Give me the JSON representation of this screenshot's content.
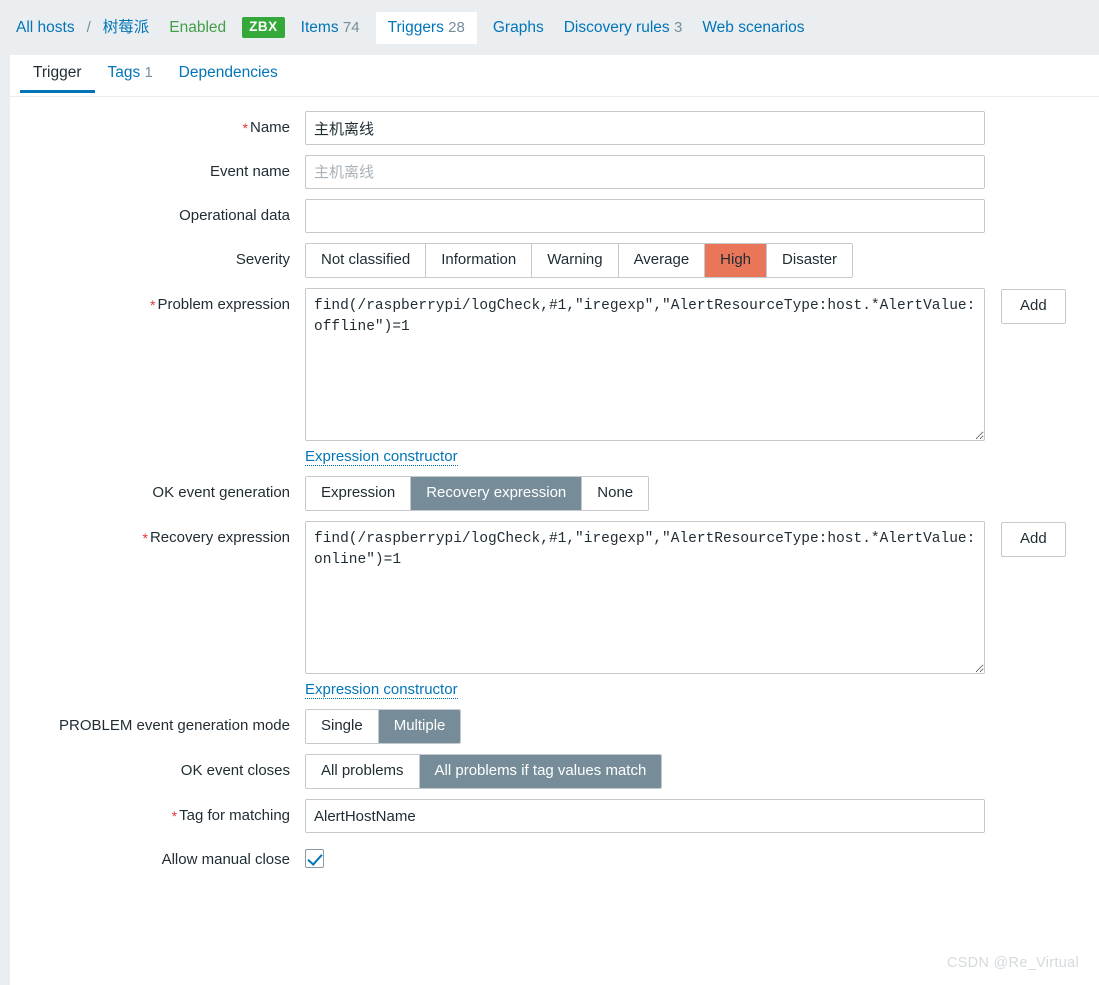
{
  "hostnav": {
    "all_hosts": "All hosts",
    "separator": "/",
    "host_name": "树莓派",
    "status": "Enabled",
    "agent_badge": "ZBX",
    "items_label": "Items",
    "items_count": "74",
    "triggers_label": "Triggers",
    "triggers_count": "28",
    "graphs_label": "Graphs",
    "discovery_label": "Discovery rules",
    "discovery_count": "3",
    "web_label": "Web scenarios"
  },
  "tabs": {
    "trigger": "Trigger",
    "tags": "Tags",
    "tags_count": "1",
    "dependencies": "Dependencies"
  },
  "form": {
    "name": {
      "label": "Name",
      "value": "主机离线",
      "placeholder": ""
    },
    "event_name": {
      "label": "Event name",
      "value": "",
      "placeholder": "主机离线"
    },
    "operational_data": {
      "label": "Operational data",
      "value": "",
      "placeholder": ""
    },
    "severity": {
      "label": "Severity",
      "options": [
        "Not classified",
        "Information",
        "Warning",
        "Average",
        "High",
        "Disaster"
      ],
      "selected": "High",
      "selected_color": "#e97659"
    },
    "problem_expression": {
      "label": "Problem expression",
      "value": "find(/raspberrypi/logCheck,#1,\"iregexp\",\"AlertResourceType:host.*AlertValue:offline\")=1",
      "add_label": "Add",
      "constructor_label": "Expression constructor"
    },
    "ok_event_generation": {
      "label": "OK event generation",
      "options": [
        "Expression",
        "Recovery expression",
        "None"
      ],
      "selected": "Recovery expression"
    },
    "recovery_expression": {
      "label": "Recovery expression",
      "value": "find(/raspberrypi/logCheck,#1,\"iregexp\",\"AlertResourceType:host.*AlertValue:online\")=1",
      "add_label": "Add",
      "constructor_label": "Expression constructor"
    },
    "problem_event_generation_mode": {
      "label": "PROBLEM event generation mode",
      "options": [
        "Single",
        "Multiple"
      ],
      "selected": "Multiple"
    },
    "ok_event_closes": {
      "label": "OK event closes",
      "options": [
        "All problems",
        "All problems if tag values match"
      ],
      "selected": "All problems if tag values match"
    },
    "tag_for_matching": {
      "label": "Tag for matching",
      "value": "AlertHostName",
      "placeholder": ""
    },
    "allow_manual_close": {
      "label": "Allow manual close",
      "checked": true
    }
  },
  "watermark": "CSDN @Re_Virtual",
  "colors": {
    "link": "#0275b8",
    "enabled": "#429e47",
    "badge": "#34a93a",
    "selected": "#768d99",
    "required": "#e33734"
  }
}
